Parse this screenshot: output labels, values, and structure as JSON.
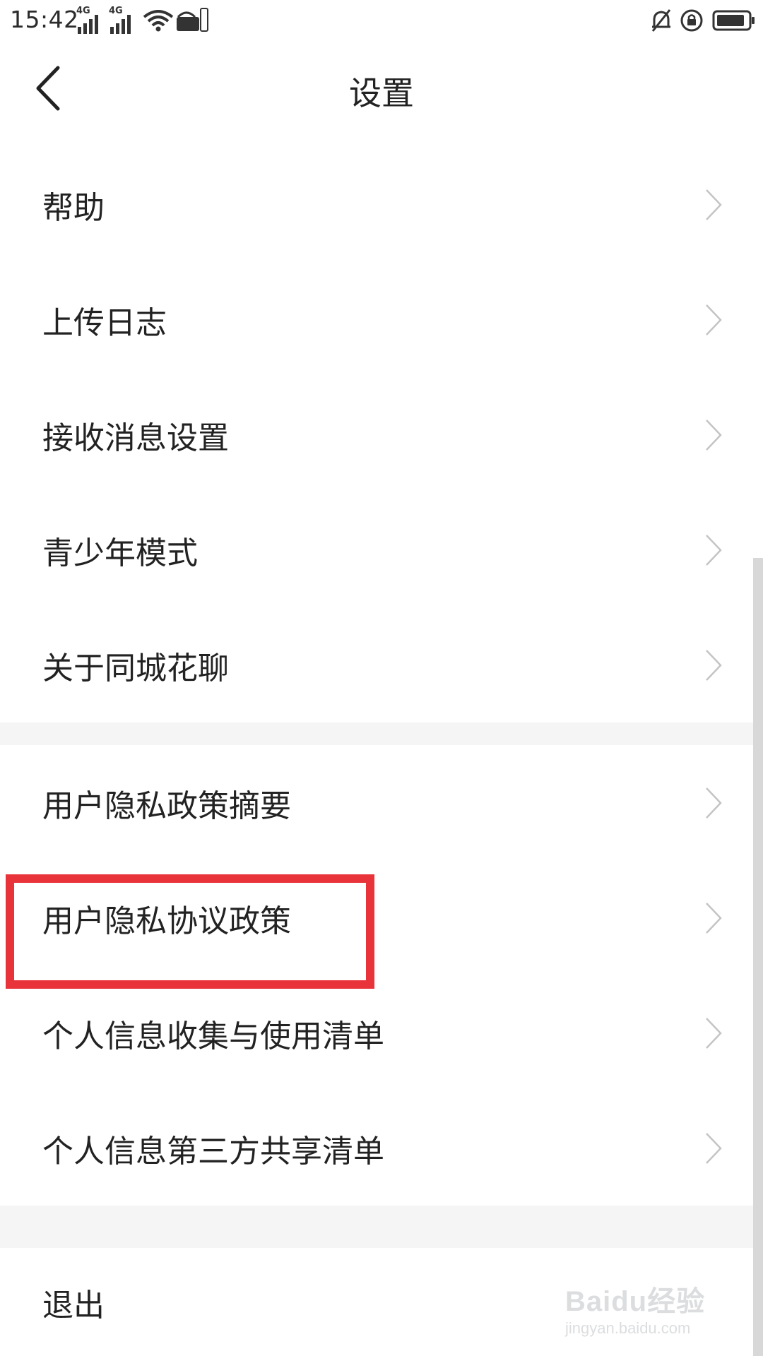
{
  "status_bar": {
    "time": "15:42",
    "signal1_label": "4G",
    "signal2_label": "4G",
    "icons": [
      "signal-icon",
      "signal-icon",
      "wifi-icon",
      "hd-icon",
      "mute-bell-icon",
      "rotation-lock-icon",
      "battery-icon"
    ]
  },
  "header": {
    "title": "设置",
    "back_icon": "chevron-left-icon"
  },
  "menu": {
    "group1": [
      {
        "label": "帮助"
      },
      {
        "label": "上传日志"
      },
      {
        "label": "接收消息设置"
      },
      {
        "label": "青少年模式"
      },
      {
        "label": "关于同城花聊"
      }
    ],
    "group2": [
      {
        "label": "用户隐私政策摘要"
      },
      {
        "label": "用户隐私协议政策"
      },
      {
        "label": "个人信息收集与使用清单"
      },
      {
        "label": "个人信息第三方共享清单"
      }
    ],
    "group3": [
      {
        "label": "退出"
      }
    ]
  },
  "highlight_color": "#e8333a",
  "watermark": {
    "brand": "Baidu经验",
    "url": "jingyan.baidu.com"
  }
}
